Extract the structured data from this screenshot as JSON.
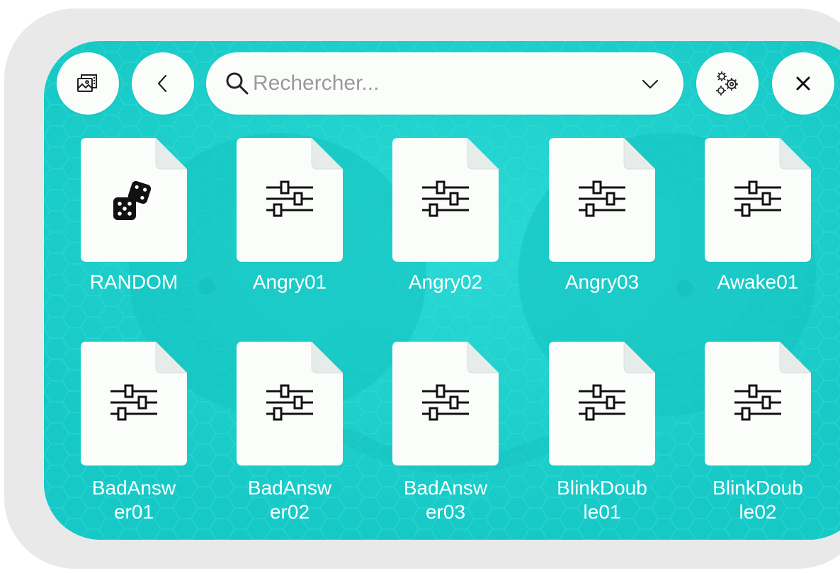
{
  "toolbar": {
    "gallery_icon": "gallery-icon",
    "back_icon": "chevron-left-icon",
    "settings_icon": "gears-icon",
    "close_icon": "close-icon"
  },
  "search": {
    "placeholder": "Rechercher...",
    "value": "",
    "icon": "search-icon",
    "dropdown_icon": "chevron-down-icon"
  },
  "items": [
    {
      "label": "RANDOM",
      "icon": "dice-icon"
    },
    {
      "label": "Angry01",
      "icon": "sliders-icon"
    },
    {
      "label": "Angry02",
      "icon": "sliders-icon"
    },
    {
      "label": "Angry03",
      "icon": "sliders-icon"
    },
    {
      "label": "Awake01",
      "icon": "sliders-icon"
    },
    {
      "label": "BadAnsw\ner01",
      "icon": "sliders-icon"
    },
    {
      "label": "BadAnsw\ner02",
      "icon": "sliders-icon"
    },
    {
      "label": "BadAnsw\ner03",
      "icon": "sliders-icon"
    },
    {
      "label": "BlinkDoub\nle01",
      "icon": "sliders-icon"
    },
    {
      "label": "BlinkDoub\nle02",
      "icon": "sliders-icon"
    }
  ],
  "colors": {
    "background": "#1ed1ce",
    "frame": "#e9e9e9",
    "tile": "#fbfdfb",
    "label": "#ffffff",
    "icon": "#111111"
  }
}
